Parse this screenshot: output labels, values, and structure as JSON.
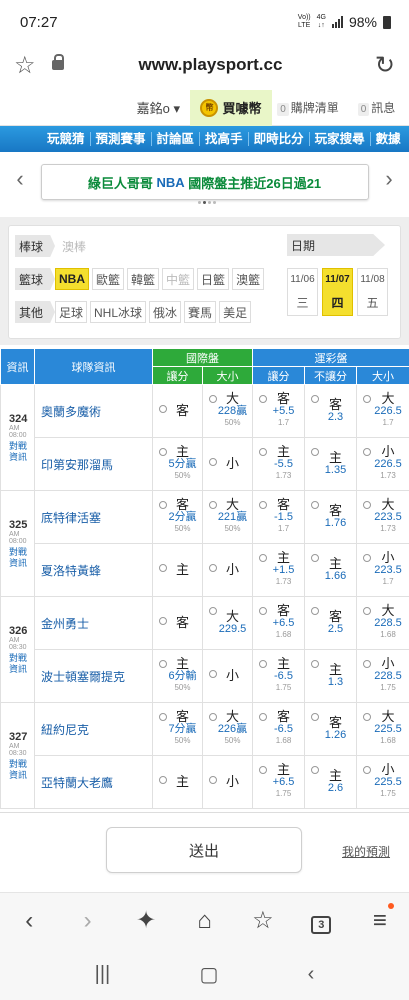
{
  "status": {
    "time": "07:27",
    "net1": "Vo))\nLTE",
    "net2": "4G\n↓↑",
    "battery": "98%"
  },
  "browser": {
    "url": "www.playsport.cc"
  },
  "userbar": {
    "user": "嘉銘o ▾",
    "buy": "買噱幣",
    "cart_count": "0",
    "cart": "購牌清單",
    "msg_count": "0",
    "msg": "訊息"
  },
  "nav": [
    "玩競猜",
    "預測賽事",
    "討論區",
    "找高手",
    "即時比分",
    "玩家搜尋",
    "數據"
  ],
  "banner": {
    "prefix": "綠巨人哥哥 ",
    "highlight": "NBA",
    "suffix": " 國際盤主推近26日過21"
  },
  "filter": {
    "row1": {
      "label": "棒球",
      "options": [
        "澳棒"
      ]
    },
    "row2": {
      "label": "籃球",
      "options": [
        "NBA",
        "歐籃",
        "韓籃",
        "中籃",
        "日籃",
        "澳籃"
      ]
    },
    "row3": {
      "label": "其他",
      "options": [
        "足球",
        "NHL冰球",
        "俄冰",
        "賽馬",
        "美足"
      ]
    },
    "date_label": "日期",
    "days": [
      {
        "md": "11/06",
        "wd": "三"
      },
      {
        "md": "11/07",
        "wd": "四"
      },
      {
        "md": "11/08",
        "wd": "五"
      }
    ]
  },
  "table": {
    "h_info": "資訊",
    "h_team": "球隊資訊",
    "h_intl": "國際盤",
    "h_lottery": "運彩盤",
    "h_spread": "讓分",
    "h_total": "大小",
    "h_lspread": "讓分",
    "h_nospread": "不讓分",
    "h_ltotal": "大小",
    "games": [
      {
        "num": "324",
        "time": "AM 08:00",
        "link": "對戰\n資訊",
        "away": {
          "team": "奧蘭多魔術",
          "s": [
            "客",
            "",
            ""
          ],
          "t": [
            "大",
            "228贏",
            "50%"
          ],
          "ls": [
            "客",
            "+5.5",
            "1.7"
          ],
          "ns": [
            "客",
            "2.3"
          ],
          "lt": [
            "大",
            "226.5",
            "1.7"
          ]
        },
        "home": {
          "team": "印第安那溜馬",
          "s": [
            "主",
            "5分贏",
            "50%"
          ],
          "t": [
            "小",
            "",
            ""
          ],
          "ls": [
            "主",
            "-5.5",
            "1.73"
          ],
          "ns": [
            "主",
            "1.35"
          ],
          "lt": [
            "小",
            "226.5",
            "1.73"
          ]
        }
      },
      {
        "num": "325",
        "time": "AM 08:00",
        "link": "對戰\n資訊",
        "away": {
          "team": "底特律活塞",
          "s": [
            "客",
            "2分贏",
            "50%"
          ],
          "t": [
            "大",
            "221贏",
            "50%"
          ],
          "ls": [
            "客",
            "-1.5",
            "1.7"
          ],
          "ns": [
            "客",
            "1.76"
          ],
          "lt": [
            "大",
            "223.5",
            "1.73"
          ]
        },
        "home": {
          "team": "夏洛特黃蜂",
          "s": [
            "主",
            "",
            ""
          ],
          "t": [
            "小",
            "",
            ""
          ],
          "ls": [
            "主",
            "+1.5",
            "1.73"
          ],
          "ns": [
            "主",
            "1.66"
          ],
          "lt": [
            "小",
            "223.5",
            "1.7"
          ]
        }
      },
      {
        "num": "326",
        "time": "AM 08:30",
        "link": "對戰\n資訊",
        "away": {
          "team": "金州勇士",
          "s": [
            "客",
            "",
            ""
          ],
          "t": [
            "大",
            "229.5",
            ""
          ],
          "ls": [
            "客",
            "+6.5",
            "1.68"
          ],
          "ns": [
            "客",
            "2.5"
          ],
          "lt": [
            "大",
            "228.5",
            "1.68"
          ]
        },
        "home": {
          "team": "波士頓塞爾提克",
          "s": [
            "主",
            "6分輸",
            "50%"
          ],
          "t": [
            "小",
            "",
            ""
          ],
          "ls": [
            "主",
            "-6.5",
            "1.75"
          ],
          "ns": [
            "主",
            "1.3"
          ],
          "lt": [
            "小",
            "228.5",
            "1.75"
          ]
        }
      },
      {
        "num": "327",
        "time": "AM 08:30",
        "link": "對戰\n資訊",
        "away": {
          "team": "紐約尼克",
          "s": [
            "客",
            "7分贏",
            "50%"
          ],
          "t": [
            "大",
            "226贏",
            "50%"
          ],
          "ls": [
            "客",
            "-6.5",
            "1.68"
          ],
          "ns": [
            "客",
            "1.26"
          ],
          "lt": [
            "大",
            "225.5",
            "1.68"
          ]
        },
        "home": {
          "team": "亞特蘭大老鷹",
          "s": [
            "主",
            "",
            ""
          ],
          "t": [
            "小",
            "",
            ""
          ],
          "ls": [
            "主",
            "+6.5",
            "1.75"
          ],
          "ns": [
            "主",
            "2.6"
          ],
          "lt": [
            "小",
            "225.5",
            "1.75"
          ]
        }
      }
    ]
  },
  "footer": {
    "submit": "送出",
    "my_predictions": "我的預測"
  },
  "browserbar": {
    "tabs_count": "3"
  },
  "colors": {
    "nav_blue": "#1f88d6",
    "lottery_green": "#2eaa3a",
    "selected_yellow": "#f4df2e",
    "banner_green": "#0a8a3a"
  }
}
